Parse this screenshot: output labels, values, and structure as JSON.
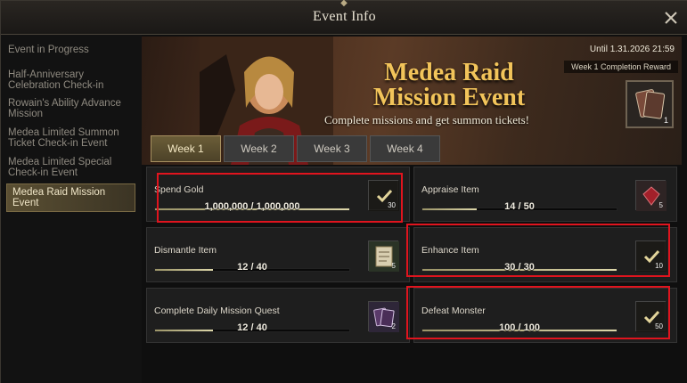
{
  "window": {
    "title": "Event Info"
  },
  "sidebar": {
    "items": [
      {
        "label": "Event in Progress",
        "active": false
      },
      {
        "label": "Half-Anniversary Celebration Check-in",
        "active": false
      },
      {
        "label": "Rowain's Ability Advance Mission",
        "active": false
      },
      {
        "label": "Medea Limited Summon Ticket Check-in Event",
        "active": false
      },
      {
        "label": "Medea Limited Special Check-in Event",
        "active": false
      },
      {
        "label": "Medea Raid Mission Event",
        "active": true
      }
    ]
  },
  "banner": {
    "title_line1": "Medea Raid",
    "title_line2": "Mission Event",
    "subtitle": "Complete missions and get summon tickets!",
    "until": "Until 1.31.2026 21:59",
    "reward_label": "Week 1 Completion Reward",
    "reward_count": "1"
  },
  "tabs": [
    {
      "label": "Week 1",
      "active": true
    },
    {
      "label": "Week 2",
      "active": false
    },
    {
      "label": "Week 3",
      "active": false
    },
    {
      "label": "Week 4",
      "active": false
    }
  ],
  "missions": [
    {
      "name": "Spend Gold",
      "progress": "1,000,000 / 1,000,000",
      "fraction": 1.0,
      "reward_count": "30",
      "reward_icon": "checkmark-icon",
      "completed": true,
      "highlighted": true
    },
    {
      "name": "Appraise Item",
      "progress": "14 / 50",
      "fraction": 0.28,
      "reward_count": "5",
      "reward_icon": "red-gem-icon",
      "completed": false,
      "highlighted": false
    },
    {
      "name": "Dismantle Item",
      "progress": "12 / 40",
      "fraction": 0.3,
      "reward_count": "5",
      "reward_icon": "scroll-icon",
      "completed": false,
      "highlighted": false
    },
    {
      "name": "Enhance Item",
      "progress": "30 / 30",
      "fraction": 1.0,
      "reward_count": "10",
      "reward_icon": "checkmark-icon",
      "completed": true,
      "highlighted": true
    },
    {
      "name": "Complete Daily Mission Quest",
      "progress": "12 / 40",
      "fraction": 0.3,
      "reward_count": "2",
      "reward_icon": "summon-ticket-icon",
      "completed": false,
      "highlighted": false
    },
    {
      "name": "Defeat Monster",
      "progress": "100 / 100",
      "fraction": 1.0,
      "reward_count": "50",
      "reward_icon": "checkmark-icon",
      "completed": true,
      "highlighted": true
    }
  ],
  "colors": {
    "highlight": "#e0141e",
    "accent_gold": "#f2c45a",
    "progress_fill": "#dcd6a8"
  }
}
